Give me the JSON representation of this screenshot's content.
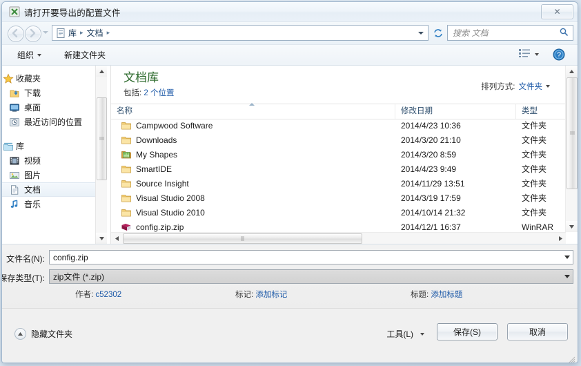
{
  "window": {
    "title": "请打开要导出的配置文件",
    "title_icon": "app-icon",
    "close_label": "✕"
  },
  "nav": {
    "back_tooltip": "后退",
    "forward_tooltip": "前进",
    "breadcrumbs": [
      "库",
      "文档"
    ],
    "separator": "▸",
    "address_icon": "library-document-icon",
    "refresh_icon": "refresh-icon",
    "dropdown_icon": "chevron-down-icon"
  },
  "search": {
    "placeholder": "搜索 文档",
    "icon": "search-icon"
  },
  "commandbar": {
    "organize": "组织",
    "new_folder": "新建文件夹",
    "view_icon": "view-mode-icon",
    "help_icon": "help-icon"
  },
  "sidebar": {
    "groups": [
      {
        "root": {
          "label": "收藏夹",
          "icon": "star-icon"
        },
        "items": [
          {
            "label": "下载",
            "icon": "downloads-icon",
            "selected": false
          },
          {
            "label": "桌面",
            "icon": "desktop-icon",
            "selected": false
          },
          {
            "label": "最近访问的位置",
            "icon": "recent-places-icon",
            "selected": false
          }
        ]
      },
      {
        "root": {
          "label": "库",
          "icon": "library-icon"
        },
        "items": [
          {
            "label": "视频",
            "icon": "videos-icon",
            "selected": false
          },
          {
            "label": "图片",
            "icon": "pictures-icon",
            "selected": false
          },
          {
            "label": "文档",
            "icon": "documents-icon",
            "selected": true
          },
          {
            "label": "音乐",
            "icon": "music-icon",
            "selected": false
          }
        ]
      }
    ]
  },
  "library": {
    "title": "文档库",
    "subtitle_prefix": "包括: ",
    "subtitle_link": "2 个位置",
    "arrange_label": "排列方式:",
    "arrange_value": "文件夹"
  },
  "columns": {
    "name": "名称",
    "date": "修改日期",
    "type": "类型"
  },
  "files": [
    {
      "name": "Campwood Software",
      "date": "2014/4/23 10:36",
      "type": "文件夹",
      "icon": "folder-icon"
    },
    {
      "name": "Downloads",
      "date": "2014/3/20 21:10",
      "type": "文件夹",
      "icon": "folder-icon"
    },
    {
      "name": "My Shapes",
      "date": "2014/3/20 8:59",
      "type": "文件夹",
      "icon": "visio-shapes-icon"
    },
    {
      "name": "SmartIDE",
      "date": "2014/4/23 9:49",
      "type": "文件夹",
      "icon": "folder-icon"
    },
    {
      "name": "Source Insight",
      "date": "2014/11/29 13:51",
      "type": "文件夹",
      "icon": "folder-icon"
    },
    {
      "name": "Visual Studio 2008",
      "date": "2014/3/19 17:59",
      "type": "文件夹",
      "icon": "folder-icon"
    },
    {
      "name": "Visual Studio 2010",
      "date": "2014/10/14 21:32",
      "type": "文件夹",
      "icon": "folder-icon"
    },
    {
      "name": "config.zip.zip",
      "date": "2014/12/1 16:37",
      "type": "WinRAR",
      "icon": "winrar-archive-icon"
    }
  ],
  "form": {
    "filename_label": "文件名(N):",
    "filename_value": "config.zip",
    "filetype_label": "保存类型(T):",
    "filetype_value": "zip文件 (*.zip)",
    "author_label": "作者:",
    "author_value": "c52302",
    "tags_label": "标记:",
    "tags_value": "添加标记",
    "subject_label": "标题:",
    "subject_value": "添加标题"
  },
  "footer": {
    "hide_folders": "隐藏文件夹",
    "tools": "工具(L)",
    "save": "保存(S)",
    "cancel": "取消"
  },
  "colors": {
    "library_title": "#2e6b2e",
    "link": "#1e5aa8",
    "column_header": "#30506f",
    "folder": "#f6d278"
  }
}
